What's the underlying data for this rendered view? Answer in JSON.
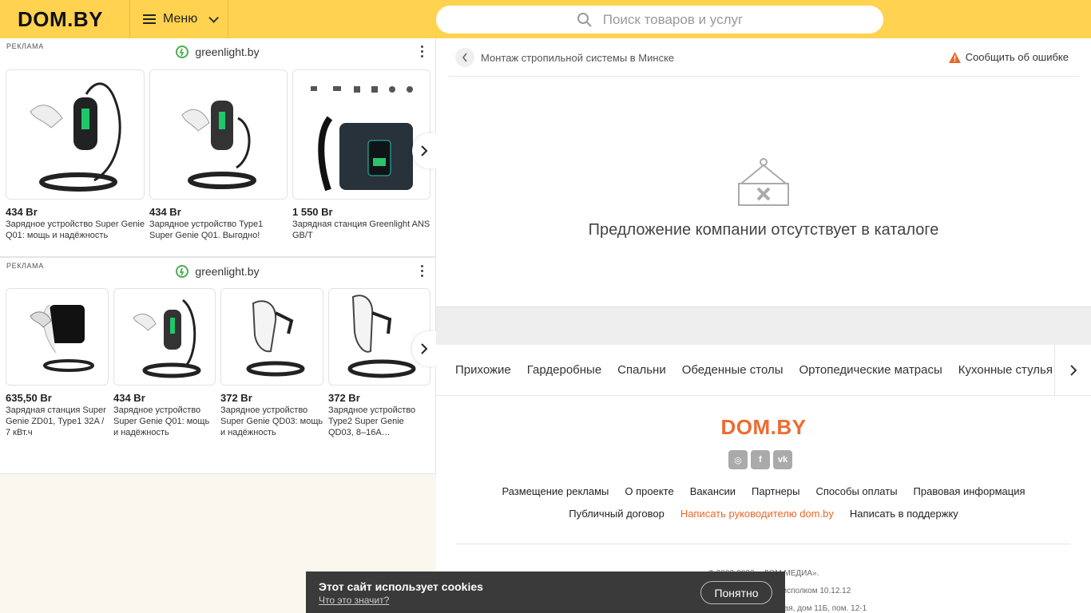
{
  "header": {
    "logo": "DOM.BY",
    "menu_label": "Меню",
    "search_placeholder": "Поиск товаров и услуг"
  },
  "ads": [
    {
      "label": "РЕКЛАМА",
      "brand": "greenlight.by",
      "products": [
        {
          "price": "434 Br",
          "title": "Зарядное устройство Super Genie Q01: мощь и надёжность"
        },
        {
          "price": "434 Br",
          "title": "Зарядное устройство Type1 Super Genie Q01. Выгодно!"
        },
        {
          "price": "1 550 Br",
          "title": "Зарядная станция Greenlight ANS GB/T"
        }
      ]
    },
    {
      "label": "РЕКЛАМА",
      "brand": "greenlight.by",
      "products": [
        {
          "price": "635,50 Br",
          "title": "Зарядная станция Super Genie ZD01, Type1 32A / 7 кВт.ч"
        },
        {
          "price": "434 Br",
          "title": "Зарядное устройство Super Genie Q01: мощь и надёжность"
        },
        {
          "price": "372 Br",
          "title": "Зарядное устройство Super Genie QD03: мощь и надёжность"
        },
        {
          "price": "372 Br",
          "title": "Зарядное устройство Type2 Super Genie QD03, 8–16А…"
        }
      ]
    }
  ],
  "main": {
    "breadcrumb": "Монтаж стропильной системы в Минске",
    "report": "Сообщить об ошибке",
    "empty_message": "Предложение компании отсутствует в каталоге"
  },
  "categories": [
    "Прихожие",
    "Гардеробные",
    "Спальни",
    "Обеденные столы",
    "Ортопедические матрасы",
    "Кухонные стулья"
  ],
  "footer": {
    "logo": "DOM.BY",
    "links_row1": [
      "Размещение рекламы",
      "О проекте",
      "Вакансии",
      "Партнеры",
      "Способы оплаты",
      "Правовая информация"
    ],
    "links_row2": [
      "Публичный договор",
      "Написать руководителю dom.by",
      "Написать в поддержку"
    ],
    "copyright": [
      "© 2003-2023, «ДОМ МЕДИА».",
      "… исполком 10.12.12",
      "… альная, дом 11Б, пом. 12-1"
    ]
  },
  "cookie": {
    "title": "Этот сайт использует cookies",
    "link": "Что это значит?",
    "button": "Понятно"
  },
  "colors": {
    "header": "#ffd34f",
    "accent": "#ee6b2f",
    "brand_green": "#4caf50"
  }
}
